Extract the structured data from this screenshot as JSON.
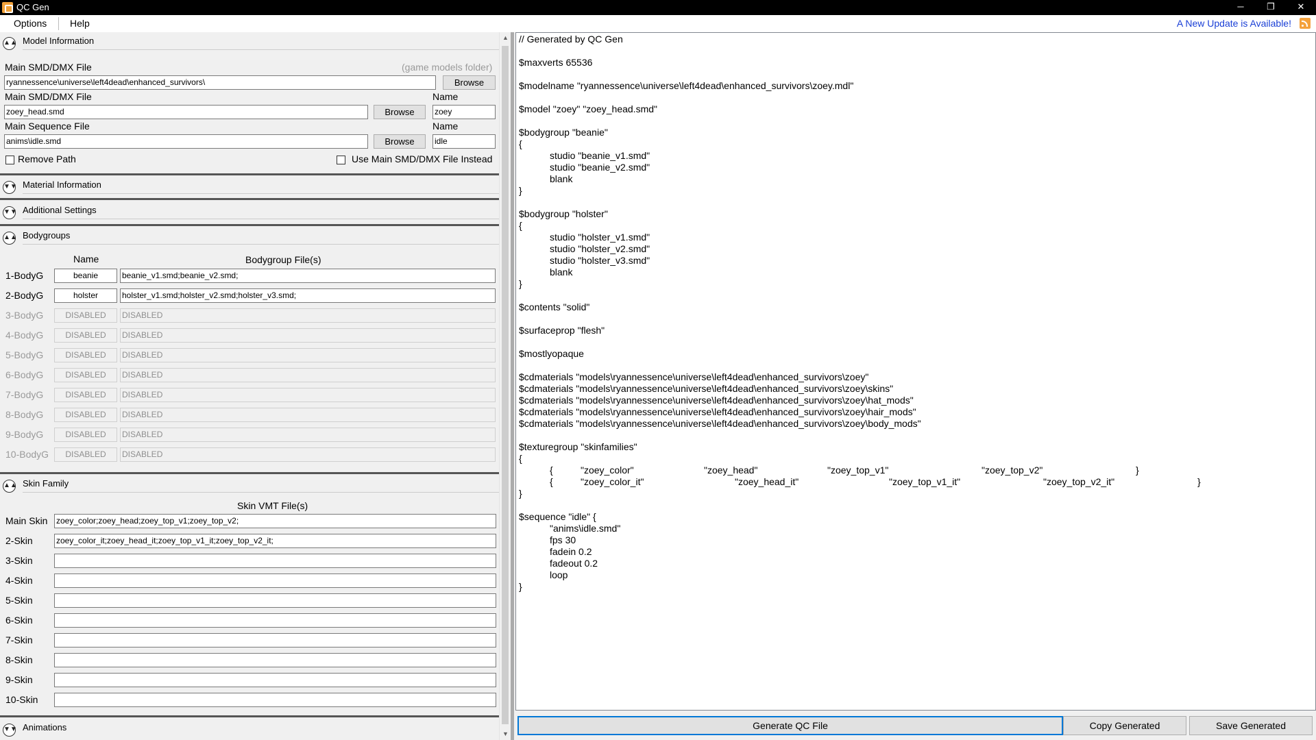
{
  "window": {
    "title": "QC Gen",
    "minimize": "─",
    "restore": "❐",
    "close": "✕"
  },
  "menu": {
    "options": "Options",
    "help": "Help",
    "update_notice": "A New Update is Available!",
    "update_icon": "rss-icon"
  },
  "model_info": {
    "header": "Model Information",
    "main_file_label": "Main SMD/DMX File",
    "game_models_hint": "(game models folder)",
    "models_folder_value": "ryannessence\\universe\\left4dead\\enhanced_survivors\\",
    "browse": "Browse",
    "smd_label": "Main SMD/DMX File",
    "smd_value": "zoey_head.smd",
    "name_label": "Name",
    "smd_name_value": "zoey",
    "sequence_label": "Main Sequence File",
    "sequence_value": "anims\\idle.smd",
    "sequence_name_value": "idle",
    "remove_path": "Remove Path",
    "use_main_smd": "Use Main SMD/DMX File Instead"
  },
  "material_info": {
    "header": "Material Information"
  },
  "additional_settings": {
    "header": "Additional Settings"
  },
  "bodygroups": {
    "header": "Bodygroups",
    "col_name": "Name",
    "col_files": "Bodygroup File(s)",
    "rows": [
      {
        "label": "1-BodyG",
        "name": "beanie",
        "files": "beanie_v1.smd;beanie_v2.smd;",
        "enabled": true
      },
      {
        "label": "2-BodyG",
        "name": "holster",
        "files": "holster_v1.smd;holster_v2.smd;holster_v3.smd;",
        "enabled": true
      },
      {
        "label": "3-BodyG",
        "name": "DISABLED",
        "files": "DISABLED",
        "enabled": false
      },
      {
        "label": "4-BodyG",
        "name": "DISABLED",
        "files": "DISABLED",
        "enabled": false
      },
      {
        "label": "5-BodyG",
        "name": "DISABLED",
        "files": "DISABLED",
        "enabled": false
      },
      {
        "label": "6-BodyG",
        "name": "DISABLED",
        "files": "DISABLED",
        "enabled": false
      },
      {
        "label": "7-BodyG",
        "name": "DISABLED",
        "files": "DISABLED",
        "enabled": false
      },
      {
        "label": "8-BodyG",
        "name": "DISABLED",
        "files": "DISABLED",
        "enabled": false
      },
      {
        "label": "9-BodyG",
        "name": "DISABLED",
        "files": "DISABLED",
        "enabled": false
      },
      {
        "label": "10-BodyG",
        "name": "DISABLED",
        "files": "DISABLED",
        "enabled": false
      }
    ]
  },
  "skin_family": {
    "header": "Skin Family",
    "col_files": "Skin VMT File(s)",
    "rows": [
      {
        "label": "Main Skin",
        "value": "zoey_color;zoey_head;zoey_top_v1;zoey_top_v2;"
      },
      {
        "label": "2-Skin",
        "value": "zoey_color_it;zoey_head_it;zoey_top_v1_it;zoey_top_v2_it;"
      },
      {
        "label": "3-Skin",
        "value": ""
      },
      {
        "label": "4-Skin",
        "value": ""
      },
      {
        "label": "5-Skin",
        "value": ""
      },
      {
        "label": "6-Skin",
        "value": ""
      },
      {
        "label": "7-Skin",
        "value": ""
      },
      {
        "label": "8-Skin",
        "value": ""
      },
      {
        "label": "9-Skin",
        "value": ""
      },
      {
        "label": "10-Skin",
        "value": ""
      }
    ]
  },
  "animations": {
    "header": "Animations"
  },
  "output": {
    "qc_text": "// Generated by QC Gen\n\n$maxverts 65536\n\n$modelname \"ryannessence\\universe\\left4dead\\enhanced_survivors\\zoey.mdl\"\n\n$model \"zoey\" \"zoey_head.smd\"\n\n$bodygroup \"beanie\"\n{\n\tstudio \"beanie_v1.smd\"\n\tstudio \"beanie_v2.smd\"\n\tblank\n}\n\n$bodygroup \"holster\"\n{\n\tstudio \"holster_v1.smd\"\n\tstudio \"holster_v2.smd\"\n\tstudio \"holster_v3.smd\"\n\tblank\n}\n\n$contents \"solid\"\n\n$surfaceprop \"flesh\"\n\n$mostlyopaque\n\n$cdmaterials \"models\\ryannessence\\universe\\left4dead\\enhanced_survivors\\zoey\"\n$cdmaterials \"models\\ryannessence\\universe\\left4dead\\enhanced_survivors\\zoey\\skins\"\n$cdmaterials \"models\\ryannessence\\universe\\left4dead\\enhanced_survivors\\zoey\\hat_mods\"\n$cdmaterials \"models\\ryannessence\\universe\\left4dead\\enhanced_survivors\\zoey\\hair_mods\"\n$cdmaterials \"models\\ryannessence\\universe\\left4dead\\enhanced_survivors\\zoey\\body_mods\"\n\n$texturegroup \"skinfamilies\"\n{\n\t{\t\"zoey_color\"\t\t\t\"zoey_head\"\t\t\t\"zoey_top_v1\"\t\t\t\"zoey_top_v2\"\t\t\t}\n\t{\t\"zoey_color_it\"\t\t\t\"zoey_head_it\"\t\t\t\"zoey_top_v1_it\"\t\t\t\"zoey_top_v2_it\"\t\t\t}\n}\n\n$sequence \"idle\" {\n\t\"anims\\idle.smd\"\n\tfps 30\n\tfadein 0.2\n\tfadeout 0.2\n\tloop\n}",
    "generate": "Generate QC File",
    "copy": "Copy Generated",
    "save": "Save Generated"
  }
}
